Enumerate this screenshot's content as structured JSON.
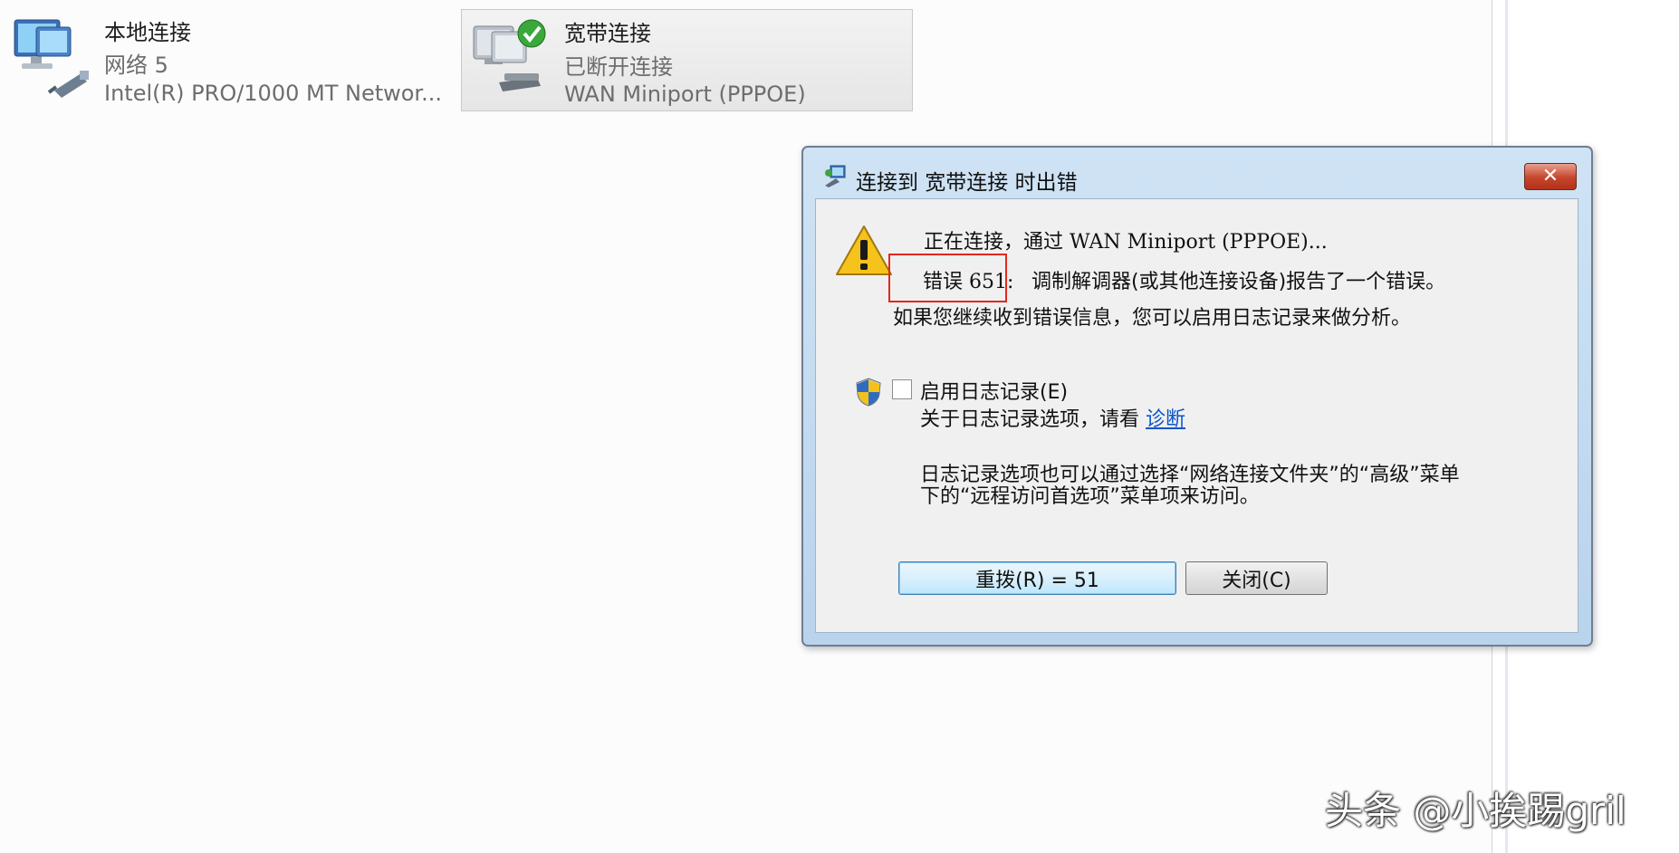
{
  "connections": [
    {
      "name": "本地连接",
      "network": "网络  5",
      "device": "Intel(R) PRO/1000 MT Networ..."
    },
    {
      "name": "宽带连接",
      "status": "已断开连接",
      "device": "WAN Miniport (PPPOE)"
    }
  ],
  "dialog": {
    "title": "连接到 宽带连接 时出错",
    "close_symbol": "✕",
    "connecting_line": "正在连接，通过 WAN Miniport (PPPOE)...",
    "error_code": "错误 651:",
    "error_message": "调制解调器(或其他连接设备)报告了一个错误。",
    "advice": "如果您继续收到错误信息，您可以启用日志记录来做分析。",
    "logging_checkbox_label": "启用日志记录(E)",
    "logging_checked": false,
    "logging_info_prefix": "关于日志记录选项，请看",
    "diagnose_link": "诊断",
    "logging_note_line1": "日志记录选项也可以通过选择“网络连接文件夹”的“高级”菜单",
    "logging_note_line2": "下的“远程访问首选项”菜单项来访问。",
    "redial_button": "重拨(R) = 51",
    "close_button": "关闭(C)"
  },
  "watermark": "头条 @小挨踢gril",
  "colors": {
    "highlight_box": "#e3271d",
    "link": "#0a55c8",
    "dialog_frame": "#b9d3ec",
    "close_button": "#c6452c"
  },
  "icons": {
    "local_connection": "network-adapter-icon",
    "broadband_connection": "dialup-connected-icon",
    "dialog_title": "network-connection-icon",
    "warning": "warning-triangle-icon",
    "shield": "uac-shield-icon"
  }
}
